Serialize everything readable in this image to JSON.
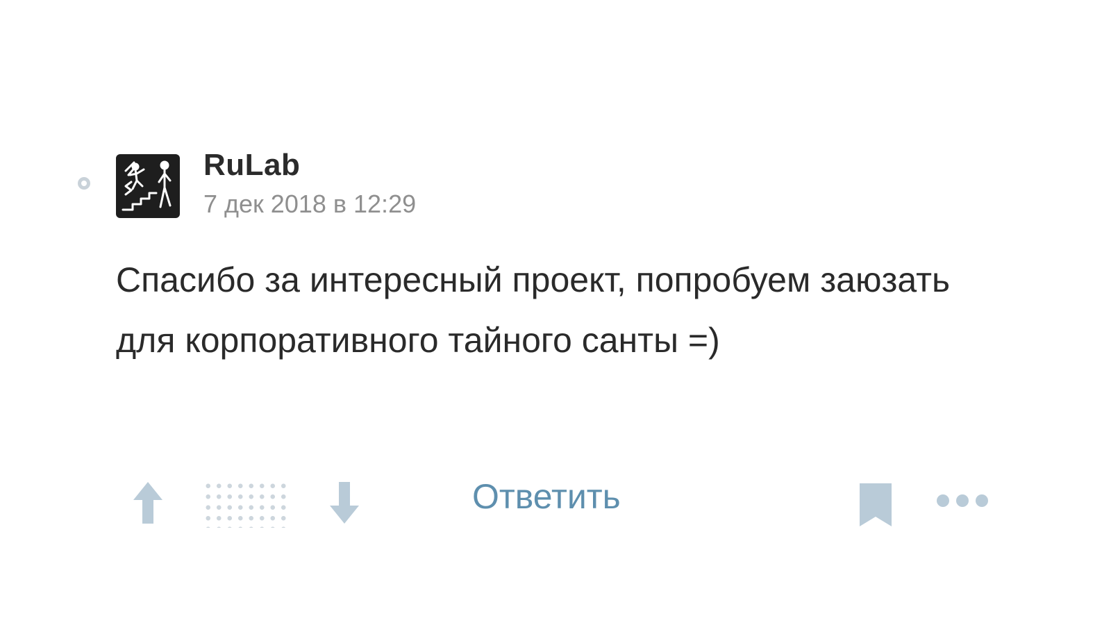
{
  "comment": {
    "author": "RuLab",
    "timestamp": "7 дек 2018 в 12:29",
    "text": "Спасибо за интересный проект, попробуем заюзать для корпоративного тайного санты =)",
    "avatar_icon": "staircase-people-icon",
    "read_marker_icon": "unread-circle-icon"
  },
  "actions": {
    "vote_up_icon": "arrow-up-icon",
    "score_state": "hidden",
    "vote_down_icon": "arrow-down-icon",
    "reply_label": "Ответить",
    "bookmark_icon": "bookmark-icon",
    "more_icon": "more-dots-icon"
  },
  "colors": {
    "icon_gray_blue": "#b9cbd8",
    "link_blue": "#5e8fae",
    "date_gray": "#8f8f8f",
    "text_dark": "#2a2a2a"
  }
}
